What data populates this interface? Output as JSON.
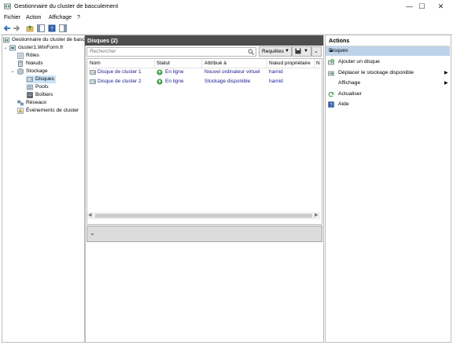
{
  "window": {
    "title": "Gestionnaire du cluster de basculement",
    "controls": {
      "minimize": "—",
      "maximize": "☐",
      "close": "✕"
    }
  },
  "menu": {
    "items": [
      "Fichier",
      "Action",
      "Affichage",
      "?"
    ]
  },
  "tree": {
    "root": "Gestionnaire du cluster de basc",
    "cluster": "cluster1.WinForm.fr",
    "roles": "Rôles",
    "nodes": "Nœuds",
    "storage": "Stockage",
    "disks": "Disques",
    "pools": "Pools",
    "enclosures": "Boîtiers",
    "networks": "Réseaux",
    "events": "Événements de cluster"
  },
  "center": {
    "title": "Disques (2)",
    "search_placeholder": "Rechercher",
    "queries_label": "Requêtes",
    "columns": [
      "Nom",
      "Statut",
      "Attribué à",
      "Nœud propriétaire",
      "N"
    ],
    "rows": [
      {
        "name": "Disque de cluster 1",
        "status": "En ligne",
        "assigned": "Nouvel ordinateur virtuel",
        "owner": "hamid"
      },
      {
        "name": "Disque de cluster 2",
        "status": "En ligne",
        "assigned": "Stockage disponible",
        "owner": "hamid"
      }
    ]
  },
  "actions": {
    "title": "Actions",
    "section": "Disques",
    "items": [
      {
        "label": "Ajouter un disque",
        "icon": "add-disk-icon"
      },
      {
        "label": "Déplacer le stockage disponible",
        "icon": "move-storage-icon",
        "submenu": true
      },
      {
        "label": "Affichage",
        "icon": "none",
        "submenu": true
      },
      {
        "label": "Actualiser",
        "icon": "refresh-icon"
      },
      {
        "label": "Aide",
        "icon": "help-icon"
      }
    ]
  },
  "colors": {
    "accent_header": "#4d4d4d",
    "section_highlight": "#bcd3ea",
    "status_green": "#2e9b3a"
  }
}
